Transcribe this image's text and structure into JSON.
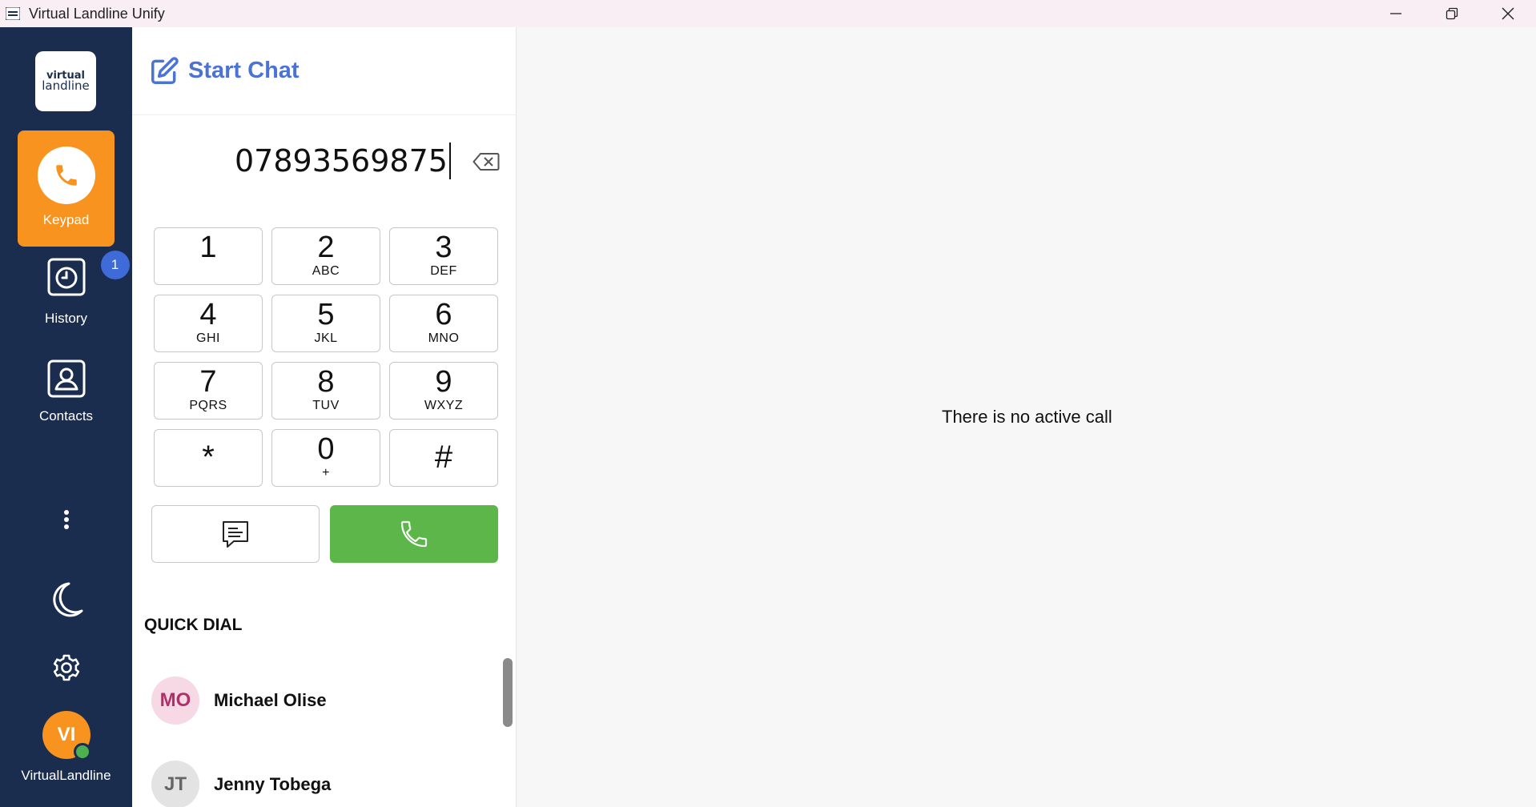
{
  "window": {
    "title": "Virtual Landline Unify"
  },
  "sidebar": {
    "logo_line1": "virtual",
    "logo_line2": "landline",
    "items": [
      {
        "label": "Keypad",
        "icon": "phone-icon",
        "active": true
      },
      {
        "label": "History",
        "icon": "clock-icon",
        "badge": "1"
      },
      {
        "label": "Contacts",
        "icon": "contact-card-icon"
      }
    ],
    "user": {
      "initials": "VI",
      "name": "VirtualLandline",
      "status": "online"
    }
  },
  "dialer": {
    "header_title": "Start Chat",
    "number": "07893569875",
    "keys": [
      {
        "digit": "1",
        "letters": ""
      },
      {
        "digit": "2",
        "letters": "ABC"
      },
      {
        "digit": "3",
        "letters": "DEF"
      },
      {
        "digit": "4",
        "letters": "GHI"
      },
      {
        "digit": "5",
        "letters": "JKL"
      },
      {
        "digit": "6",
        "letters": "MNO"
      },
      {
        "digit": "7",
        "letters": "PQRS"
      },
      {
        "digit": "8",
        "letters": "TUV"
      },
      {
        "digit": "9",
        "letters": "WXYZ"
      },
      {
        "digit": "*",
        "letters": ""
      },
      {
        "digit": "0",
        "letters": "+"
      },
      {
        "digit": "#",
        "letters": ""
      }
    ],
    "quick_dial_title": "QUICK DIAL",
    "quick_dial": [
      {
        "initials": "MO",
        "name": "Michael Olise"
      },
      {
        "initials": "JT",
        "name": "Jenny Tobega"
      }
    ]
  },
  "main": {
    "status_text": "There is no active call"
  },
  "colors": {
    "sidebar_bg": "#1b2d4f",
    "accent_orange": "#f7931e",
    "call_green": "#5cb64a",
    "title_blue": "#4b73d6",
    "badge_blue": "#3f6bd8"
  }
}
